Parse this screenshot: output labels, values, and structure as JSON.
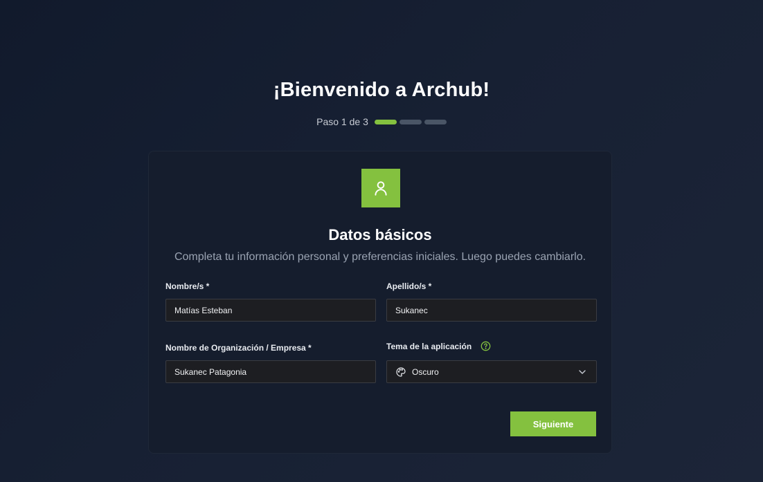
{
  "header": {
    "title": "¡Bienvenido a Archub!",
    "step_text": "Paso 1 de 3",
    "total_steps": 3,
    "current_step": 1
  },
  "card": {
    "icon": "user-icon",
    "title": "Datos básicos",
    "subtitle": "Completa tu información personal y preferencias iniciales. Luego puedes cambiarlo."
  },
  "form": {
    "first_name": {
      "label": "Nombre/s *",
      "value": "Matías Esteban"
    },
    "last_name": {
      "label": "Apellido/s *",
      "value": "Sukanec"
    },
    "organization": {
      "label": "Nombre de Organización / Empresa *",
      "value": "Sukanec Patagonia"
    },
    "theme": {
      "label": "Tema de la aplicación",
      "value": "Oscuro",
      "icon": "palette-icon",
      "help_icon": "question-circle-icon"
    }
  },
  "actions": {
    "next_label": "Siguiente"
  },
  "colors": {
    "accent": "#84c13f",
    "background": "#151d2d",
    "inactive_step": "#4a5566"
  }
}
